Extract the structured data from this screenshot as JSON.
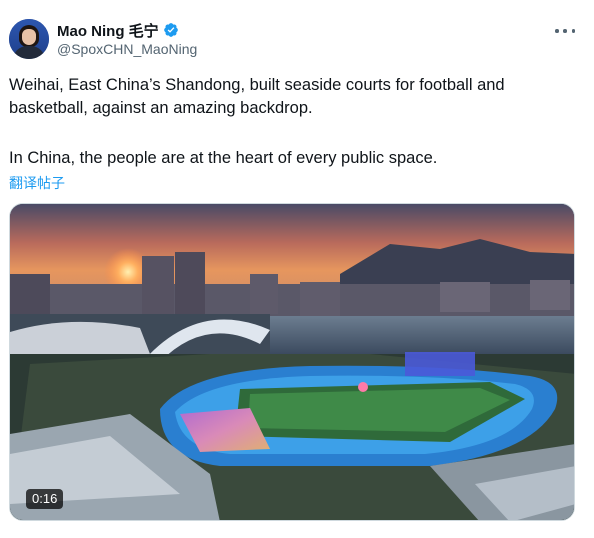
{
  "author": {
    "display_name": "Mao Ning 毛宁",
    "handle": "@SpoxCHN_MaoNing",
    "verified_icon": "verified-badge-icon",
    "verified_color": "#1d9bf0"
  },
  "menu": {
    "icon": "more-horizontal-icon"
  },
  "tweet": {
    "paragraph_1": "Weihai, East China’s Shandong, built seaside courts for football and basketball, against an amazing backdrop.",
    "paragraph_2": "In China, the people are at the heart of every public space.",
    "translate_label": "翻译帖子",
    "link_color": "#1d9bf0"
  },
  "media": {
    "type": "video",
    "duration": "0:16"
  }
}
